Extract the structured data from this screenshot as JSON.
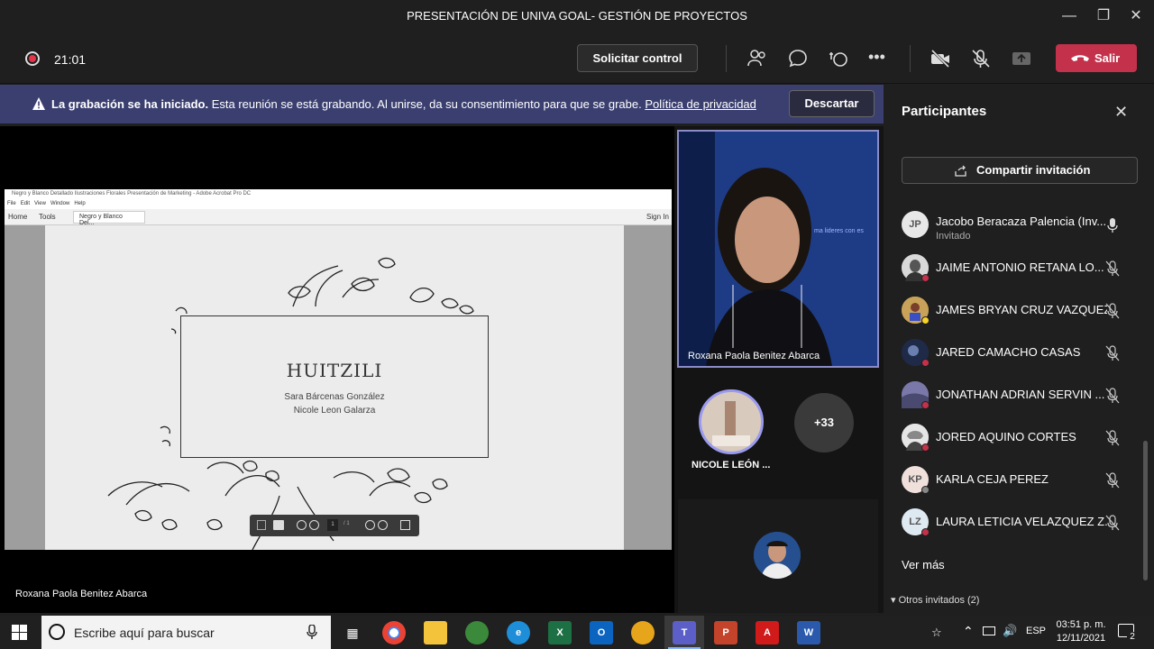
{
  "window": {
    "title": "PRESENTACIÓN DE UNIVA GOAL- GESTIÓN DE PROYECTOS"
  },
  "toolbar": {
    "timer": "21:01",
    "request_control": "Solicitar control",
    "leave": "Salir"
  },
  "banner": {
    "bold": "La grabación se ha iniciado.",
    "text": " Esta reunión se está grabando. Al unirse, da su consentimiento para que se grabe. ",
    "link": "Política de privacidad",
    "dismiss": "Descartar"
  },
  "share": {
    "window_title": "Negro y Blanco Detallado Ilustraciones Florales Presentación de Marketing - Adobe Acrobat Pro DC",
    "menu": [
      "File",
      "Edit",
      "View",
      "Window",
      "Help"
    ],
    "tabs": {
      "home": "Home",
      "tools": "Tools",
      "doc": "Negro y Blanco Del...",
      "sign_in": "Sign In"
    },
    "page": "1",
    "page_total": "/ 1",
    "slide": {
      "title": "HUITZILI",
      "line1": "Sara Bárcenas González",
      "line2": "Nicole Leon Galarza"
    },
    "presenter": "Roxana Paola Benitez Abarca"
  },
  "gallery": {
    "main_video_name": "Roxana Paola Benitez Abarca",
    "tile_name": "NICOLE LEÓN ...",
    "more_count": "+33"
  },
  "panel": {
    "title": "Participantes",
    "share_invite": "Compartir invitación",
    "participants": [
      {
        "initials": "JP",
        "name": "Jacobo Beracaza Palencia (Inv...",
        "sub": "Invitado",
        "mic": "on"
      },
      {
        "initials": "",
        "name": "JAIME ANTONIO RETANA LO...",
        "sub": "",
        "mic": "off"
      },
      {
        "initials": "",
        "name": "JAMES BRYAN CRUZ VAZQUEZ",
        "sub": "",
        "mic": "off"
      },
      {
        "initials": "",
        "name": "JARED CAMACHO CASAS",
        "sub": "",
        "mic": "off"
      },
      {
        "initials": "",
        "name": "JONATHAN ADRIAN SERVIN ...",
        "sub": "",
        "mic": "off"
      },
      {
        "initials": "",
        "name": "JORED AQUINO CORTES",
        "sub": "",
        "mic": "off"
      },
      {
        "initials": "KP",
        "name": "KARLA CEJA PEREZ",
        "sub": "",
        "mic": "off"
      },
      {
        "initials": "LZ",
        "name": "LAURA LETICIA VELAZQUEZ Z...",
        "sub": "",
        "mic": "off"
      }
    ],
    "see_more": "Ver más",
    "other_invited": "Otros invitados (2)"
  },
  "taskbar": {
    "search_placeholder": "Escribe aquí para buscar",
    "lang": "ESP",
    "time": "03:51 p. m.",
    "date": "12/11/2021",
    "notifications": "2"
  }
}
